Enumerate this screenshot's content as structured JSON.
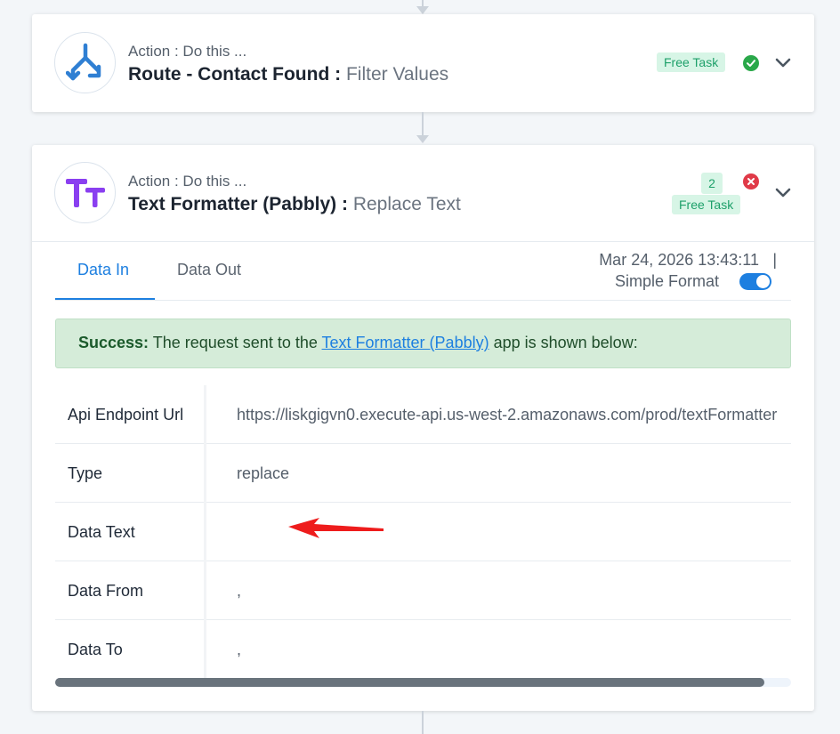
{
  "steps": [
    {
      "subtitle": "Action : Do this ...",
      "app_name": "Route - Contact Found :",
      "event": "Filter Values",
      "badge": "Free Task",
      "status": "success",
      "logo_icon": "router-split-icon"
    },
    {
      "subtitle": "Action : Do this ...",
      "app_name": "Text Formatter (Pabbly) :",
      "event": "Replace Text",
      "badge": "Free Task",
      "count": "2",
      "status": "error",
      "logo_icon": "text-formatter-icon",
      "logo_text": "Tт"
    }
  ],
  "tabs": [
    {
      "label": "Data In",
      "active": true
    },
    {
      "label": "Data Out",
      "active": false
    }
  ],
  "timestamp": "Mar 24, 2026 13:43:11",
  "timestamp_separator": "|",
  "format_toggle": {
    "label": "Simple Format",
    "on": true
  },
  "alert": {
    "strong": "Success:",
    "before": " The request sent to the ",
    "link": "Text Formatter (Pabbly)",
    "after": " app is shown below:"
  },
  "rows": [
    {
      "key": "Api Endpoint Url",
      "value": "https://liskgigvn0.execute-api.us-west-2.amazonaws.com/prod/textFormatter"
    },
    {
      "key": "Type",
      "value": "replace"
    },
    {
      "key": "Data Text",
      "value": ""
    },
    {
      "key": "Data From",
      "value": ","
    },
    {
      "key": "Data To",
      "value": ","
    }
  ],
  "colors": {
    "accent": "#1d7fe0",
    "success": "#2aa84a",
    "error": "#e03a48",
    "annotation_arrow": "#ee1c1c"
  }
}
